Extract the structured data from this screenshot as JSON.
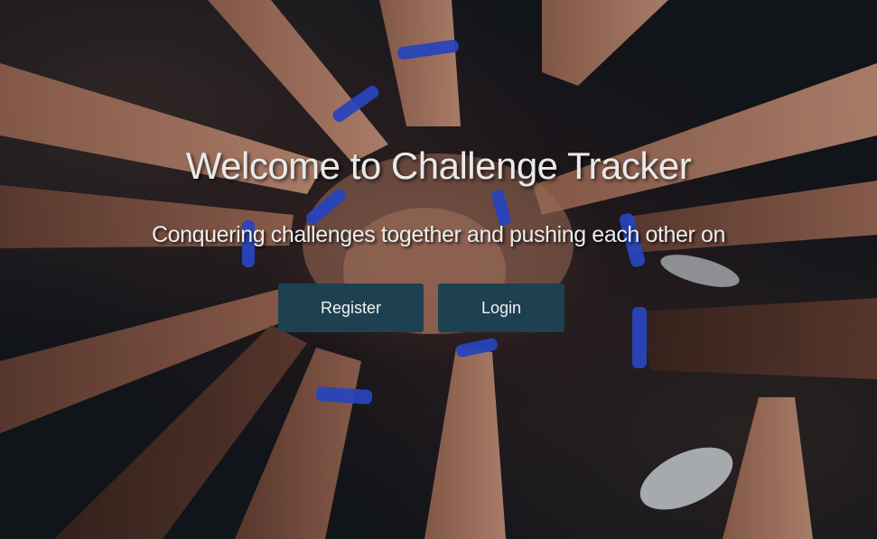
{
  "hero": {
    "title": "Welcome to Challenge Tracker",
    "subtitle": "Conquering challenges together and pushing each other on",
    "background_image": "team-hands-stacked-with-blue-wristbands-photo"
  },
  "actions": {
    "register_label": "Register",
    "login_label": "Login"
  },
  "colors": {
    "button_background": "#1d4151",
    "button_text": "#f2f2f2",
    "title_text": "#e9e9e9",
    "wristband_blue": "#2f4fd6"
  }
}
